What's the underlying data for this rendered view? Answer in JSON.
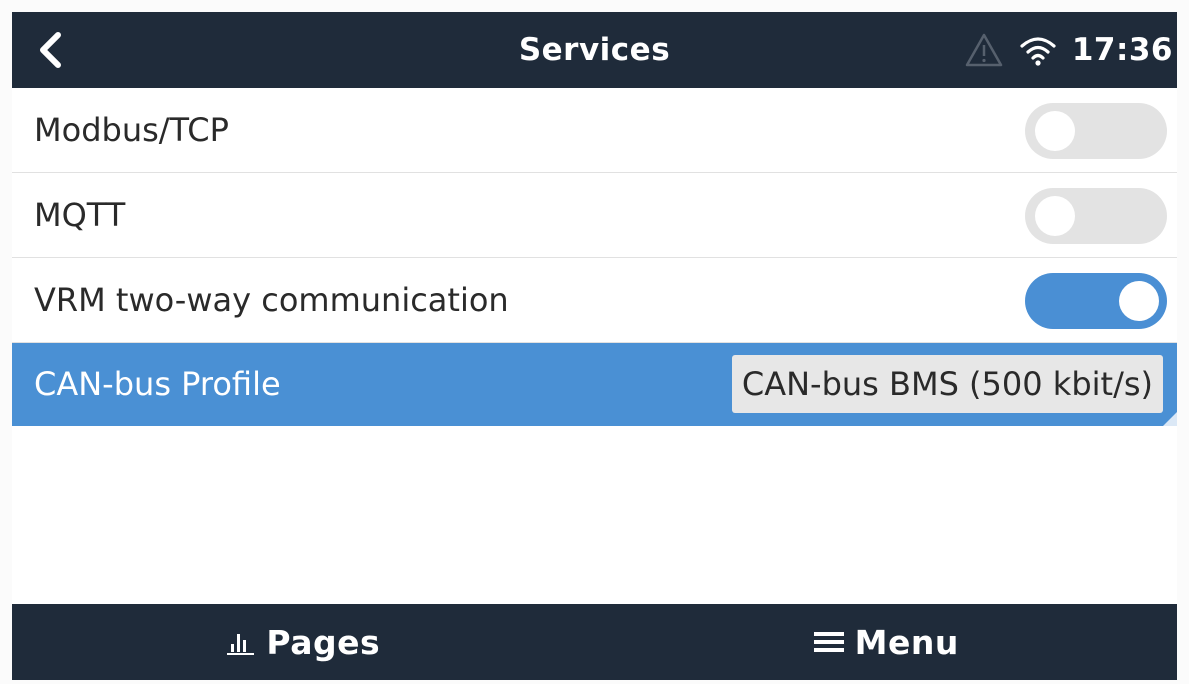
{
  "header": {
    "back_icon": "chevron-left-icon",
    "title": "Services",
    "alarm_icon": "warning-triangle-icon",
    "wifi_icon": "wifi-icon",
    "time": "17:36"
  },
  "services": {
    "items": [
      {
        "label": "Modbus/TCP",
        "control": "toggle",
        "enabled": false
      },
      {
        "label": "MQTT",
        "control": "toggle",
        "enabled": false
      },
      {
        "label": "VRM two-way communication",
        "control": "toggle",
        "enabled": true
      },
      {
        "label": "CAN-bus Profile",
        "control": "value",
        "value": "CAN-bus BMS (500 kbit/s)",
        "selected": true
      }
    ]
  },
  "footer": {
    "pages_icon": "bar-chart-icon",
    "pages_label": "Pages",
    "menu_icon": "hamburger-menu-icon",
    "menu_label": "Menu"
  },
  "colors": {
    "header_background": "#1f2b3a",
    "selection_blue": "#4a90d4",
    "toggle_on": "#4a8fd4",
    "toggle_off": "#e3e3e3"
  }
}
